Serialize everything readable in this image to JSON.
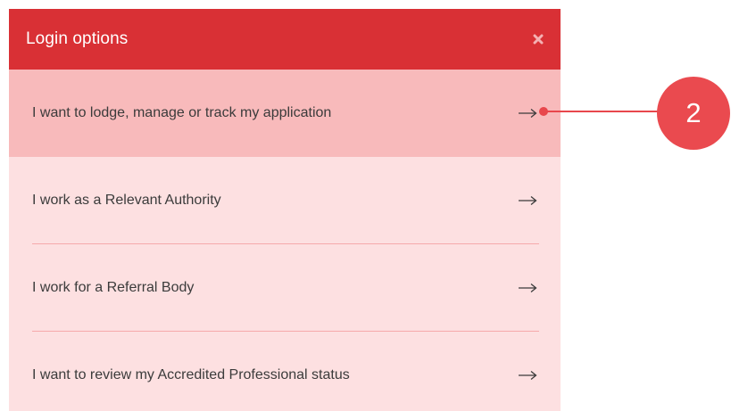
{
  "dialog": {
    "title": "Login options",
    "close_icon": "close-icon"
  },
  "options": [
    {
      "label": "I want to lodge, manage or track my application",
      "icon": "arrow-right-icon",
      "active": true
    },
    {
      "label": "I work as a Relevant Authority",
      "icon": "arrow-right-icon",
      "active": false
    },
    {
      "label": "I work for a Referral Body",
      "icon": "arrow-right-icon",
      "active": false
    },
    {
      "label": "I want to review my Accredited Professional status",
      "icon": "arrow-right-icon",
      "active": false
    }
  ],
  "callout": {
    "number": "2"
  },
  "colors": {
    "header": "#d93035",
    "panel_bg": "#fde0e1",
    "active_bg": "#f8babb",
    "callout": "#ea4a4f"
  }
}
